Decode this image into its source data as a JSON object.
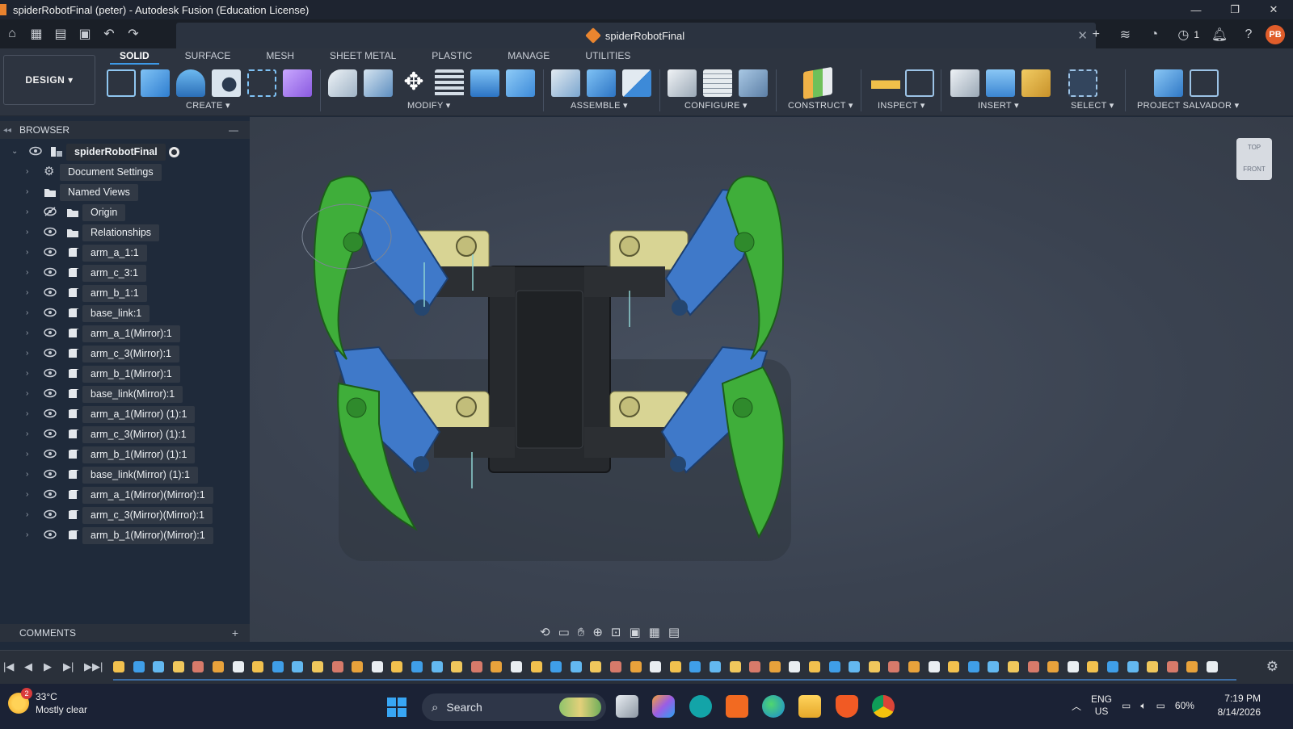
{
  "window": {
    "title": "spiderRobotFinal (peter) - Autodesk Fusion (Education License)",
    "controls": [
      "—",
      "❐",
      "✕"
    ]
  },
  "doc_tab": {
    "name": "spiderRobotFinal",
    "close": "✕"
  },
  "quick_right": {
    "jobs_count": "1",
    "avatar": "PB"
  },
  "ribbon": {
    "workspace": "DESIGN ▾",
    "tabs": [
      "SOLID",
      "SURFACE",
      "MESH",
      "SHEET METAL",
      "PLASTIC",
      "MANAGE",
      "UTILITIES"
    ],
    "groups": [
      "CREATE ▾",
      "MODIFY ▾",
      "ASSEMBLE ▾",
      "CONFIGURE ▾",
      "CONSTRUCT ▾",
      "INSPECT ▾",
      "INSERT ▾",
      "SELECT ▾",
      "PROJECT SALVADOR ▾"
    ]
  },
  "browser": {
    "title": "BROWSER",
    "root": "spiderRobotFinal",
    "items": [
      "Document Settings",
      "Named Views",
      "Origin",
      "Relationships",
      "arm_a_1:1",
      "arm_c_3:1",
      "arm_b_1:1",
      "base_link:1",
      "arm_a_1(Mirror):1",
      "arm_c_3(Mirror):1",
      "arm_b_1(Mirror):1",
      "base_link(Mirror):1",
      "arm_a_1(Mirror) (1):1",
      "arm_c_3(Mirror) (1):1",
      "arm_b_1(Mirror) (1):1",
      "base_link(Mirror) (1):1",
      "arm_a_1(Mirror)(Mirror):1",
      "arm_c_3(Mirror)(Mirror):1",
      "arm_b_1(Mirror)(Mirror):1"
    ]
  },
  "comments": {
    "title": "COMMENTS"
  },
  "viewcube": {
    "top": "TOP",
    "front": "FRONT"
  },
  "colors": {
    "accent": "#3d9ae8",
    "leg_blue": "#3f79c9",
    "leg_green": "#3fae3a",
    "servo_yellow": "#d8d494",
    "body_black": "#26292d"
  },
  "taskbar": {
    "temp": "33°C",
    "weather": "Mostly clear",
    "weather_badge": "2",
    "search": "Search",
    "lang": "ENG",
    "region": "US",
    "battery": "60%",
    "time": "7:19 PM",
    "date": "8/14/2026"
  }
}
